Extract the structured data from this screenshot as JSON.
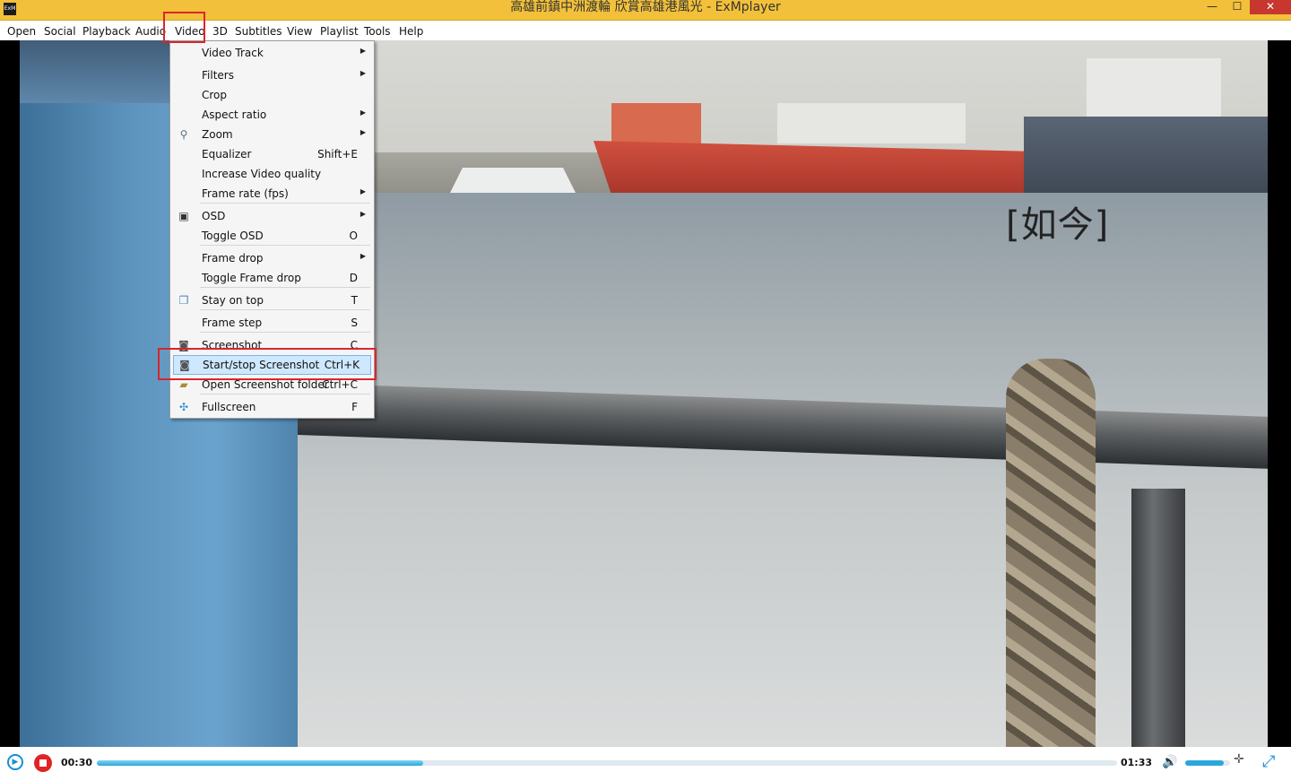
{
  "window": {
    "app_icon_text": "ExM",
    "title": "高雄前鎮中洲渡輪 欣賞高雄港風光 - ExMplayer",
    "minimize_glyph": "—",
    "maximize_glyph": "☐",
    "close_glyph": "✕"
  },
  "menubar": {
    "items": [
      "Open",
      "Social",
      "Playback",
      "Audio",
      "Video",
      "3D",
      "Subtitles",
      "View",
      "Playlist",
      "Tools",
      "Help"
    ],
    "active": "Video"
  },
  "video_menu": {
    "items": [
      {
        "label": "Video  Track",
        "shortcut": "",
        "submenu": true,
        "icon": ""
      },
      {
        "label": "Filters",
        "shortcut": "",
        "submenu": true,
        "icon": ""
      },
      {
        "label": "Crop",
        "shortcut": "",
        "submenu": false,
        "icon": ""
      },
      {
        "label": "Aspect ratio",
        "shortcut": "",
        "submenu": true,
        "icon": ""
      },
      {
        "label": "Zoom",
        "shortcut": "",
        "submenu": true,
        "icon": "magnifier-icon"
      },
      {
        "label": "Equalizer",
        "shortcut": "Shift+E",
        "submenu": false,
        "icon": ""
      },
      {
        "label": "Increase Video quality",
        "shortcut": "",
        "submenu": false,
        "icon": ""
      },
      {
        "label": "Frame rate (fps)",
        "shortcut": "",
        "submenu": true,
        "icon": ""
      },
      {
        "label": "OSD",
        "shortcut": "",
        "submenu": true,
        "icon": "monitor-icon"
      },
      {
        "label": "Toggle OSD",
        "shortcut": "O",
        "submenu": false,
        "icon": ""
      },
      {
        "label": "Frame drop",
        "shortcut": "",
        "submenu": true,
        "icon": ""
      },
      {
        "label": "Toggle Frame drop",
        "shortcut": "D",
        "submenu": false,
        "icon": ""
      },
      {
        "label": "Stay on top",
        "shortcut": "T",
        "submenu": false,
        "icon": "window-stack-icon"
      },
      {
        "label": "Frame step",
        "shortcut": "S",
        "submenu": false,
        "icon": ""
      },
      {
        "label": "Screenshot",
        "shortcut": "C",
        "submenu": false,
        "icon": "camera-icon"
      },
      {
        "label": "Start/stop Screenshot",
        "shortcut": "Ctrl+K",
        "submenu": false,
        "icon": "camera-icon",
        "highlighted": true
      },
      {
        "label": "Open Screenshot folder",
        "shortcut": "Ctrl+C",
        "submenu": false,
        "icon": "folder-icon"
      },
      {
        "label": "Fullscreen",
        "shortcut": "F",
        "submenu": false,
        "icon": "fullscreen-icon"
      }
    ],
    "submenu_arrow": "▶"
  },
  "video": {
    "subtitle": "[如今]"
  },
  "controls": {
    "current_time": "00:30",
    "total_time": "01:33",
    "progress": 0.32,
    "volume": 0.85
  },
  "colors": {
    "titlebar": "#f2c03a",
    "highlight_box": "#d9262c",
    "accent_blue": "#1a8fd6"
  }
}
